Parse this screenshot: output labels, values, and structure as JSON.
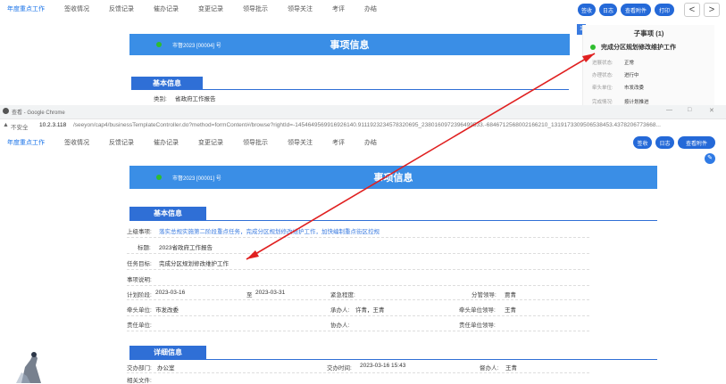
{
  "back": {
    "tabs": [
      "年度重点工作",
      "签收情况",
      "反馈记录",
      "催办记录",
      "变更记录",
      "领导批示",
      "领导关注",
      "考评",
      "办结"
    ],
    "buttons": {
      "sign": "签收",
      "log": "日志",
      "attach": "查看附件",
      "print": "打印"
    },
    "nav": {
      "prev": "<",
      "next": ">"
    },
    "badge": "1",
    "doc_no": "市督2023 [00004] 号",
    "title": "事项信息",
    "section": "基本信息",
    "category_label": "类别:",
    "category_value": "省政府工作报告",
    "side": {
      "heading": "子事项 (1)",
      "item_title": "完成分区规划修改维护工作",
      "rows": [
        {
          "label": "进展状态:",
          "value": "正常"
        },
        {
          "label": "办理状态:",
          "value": "进行中"
        },
        {
          "label": "牵头单位:",
          "value": "市发改委"
        },
        {
          "label": "完成情况:",
          "value": "按计划推进"
        }
      ]
    }
  },
  "chrome": {
    "tab_title": "查看 - Google Chrome",
    "security": "不安全",
    "url_host": "10.2.3.118",
    "url_path": "/seeyon/cap4/businessTemplateController.do?method=formContent#/browse?rightId=-1454649569916926140.9111923234578320695_2380160972396499533.-6846712568002166210_1319173309506538453.4378206773668...",
    "window_controls": [
      "—",
      "□",
      "✕"
    ]
  },
  "front": {
    "tabs": [
      "年度重点工作",
      "签收情况",
      "反馈记录",
      "催办记录",
      "变更记录",
      "领导批示",
      "领导关注",
      "考评",
      "办结"
    ],
    "buttons": {
      "sign": "签收",
      "log": "日志",
      "attach": "查看附件"
    },
    "doc_no": "市督2023 [00001] 号",
    "title": "事项信息",
    "basic": {
      "heading": "基本信息",
      "parent_label": "上级事项:",
      "parent_value": "落实总规实施第二阶段重点任务，完成分区规划修改维护工作，加快编制重点街区控规",
      "topic_label": "标题:",
      "topic_value": "2023省政府工作报告",
      "goal_label": "任务目标:",
      "goal_value": "完成分区规划修改维护工作",
      "desc_label": "事项说明:",
      "plan_label": "计划阶段:",
      "plan_start": "2023-03-16",
      "plan_to": "至",
      "plan_end": "2023-03-31",
      "urgency_label": "紧急程度:",
      "leader_label": "分管领导:",
      "leader_value": "贾青",
      "lead_unit_label": "牵头单位:",
      "lead_unit_value": "市发改委",
      "handler_label": "承办人:",
      "handler_value": "许青，王青",
      "lead_leader_label": "牵头单位领导:",
      "lead_leader_value": "王青",
      "resp_unit_label": "责任单位:",
      "assist_label": "协办人:",
      "resp_leader_label": "责任单位领导:"
    },
    "detail": {
      "heading": "详细信息",
      "dept_label": "交办部门:",
      "dept_value": "办公室",
      "time_label": "交办时间:",
      "time_value": "2023-03-16 15:43",
      "supervisor_label": "督办人:",
      "supervisor_value": "王青",
      "files_label": "相关文件:"
    }
  },
  "colors": {
    "accent": "#2469d8",
    "bar": "#3a8ee6",
    "arrow": "#e02020",
    "green": "#2ebd2e"
  }
}
